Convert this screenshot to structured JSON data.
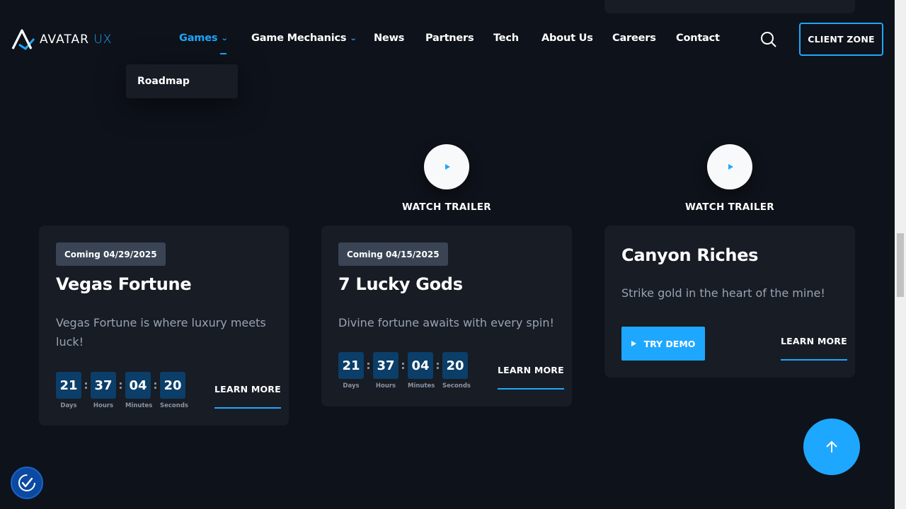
{
  "header": {
    "logo_text_main": "AVATAR",
    "logo_text_ux": "UX",
    "nav": [
      {
        "label": "Games"
      },
      {
        "label": "Game Mechanics"
      },
      {
        "label": "News"
      },
      {
        "label": "Partners"
      },
      {
        "label": "Tech"
      },
      {
        "label": "About Us"
      },
      {
        "label": "Careers"
      },
      {
        "label": "Contact"
      }
    ],
    "client_zone": "CLIENT ZONE",
    "search_icon": "search-icon"
  },
  "dropdown": {
    "items": [
      {
        "label": "Roadmap"
      }
    ]
  },
  "trailers": [
    {
      "label": "WATCH TRAILER"
    },
    {
      "label": "WATCH TRAILER"
    }
  ],
  "cards": [
    {
      "badge": "Coming 04/29/2025",
      "title": "Vegas Fortune",
      "desc": "Vegas Fortune is where luxury meets luck!",
      "countdown": {
        "days": "21",
        "hours": "37",
        "minutes": "04",
        "seconds": "20"
      },
      "learn_more": "LEARN MORE"
    },
    {
      "badge": "Coming 04/15/2025",
      "title": "7 Lucky Gods",
      "desc": "Divine fortune awaits with every spin!",
      "countdown": {
        "days": "21",
        "hours": "37",
        "minutes": "04",
        "seconds": "20"
      },
      "learn_more": "LEARN MORE"
    },
    {
      "title": "Canyon Riches",
      "desc": "Strike gold in the heart of the mine!",
      "try_demo": "TRY DEMO",
      "learn_more": "LEARN MORE"
    }
  ],
  "countdown_labels": {
    "days": "Days",
    "hours": "Hours",
    "minutes": "Minutes",
    "seconds": "Seconds"
  },
  "colors": {
    "accent": "#1ea7ff",
    "background": "#0e121a",
    "card": "#171c25",
    "countdown_box": "#0b3e68"
  }
}
